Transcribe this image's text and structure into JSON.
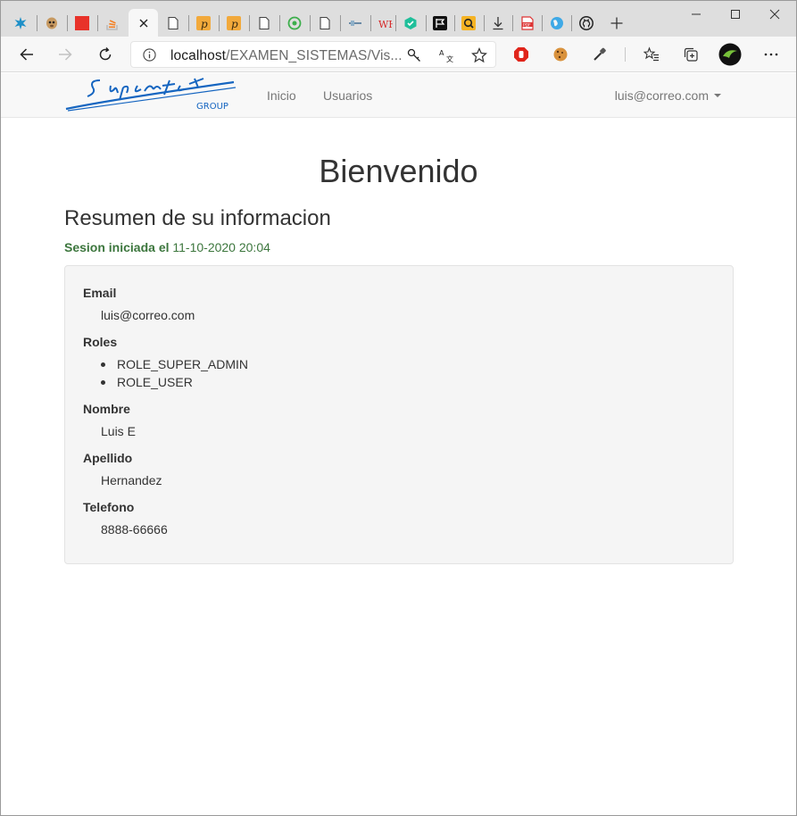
{
  "browser": {
    "url_host": "localhost",
    "url_path": "/EXAMEN_SISTEMAS/Vis...",
    "tabs": [
      {
        "icon": "star-burst-icon"
      },
      {
        "icon": "meerkat-icon"
      },
      {
        "icon": "red-square-icon"
      },
      {
        "icon": "stackoverflow-icon"
      },
      {
        "icon": "close-icon",
        "active": true
      },
      {
        "icon": "blank-page-icon"
      },
      {
        "icon": "p-badge-icon"
      },
      {
        "icon": "p-badge-icon"
      },
      {
        "icon": "blank-page-icon"
      },
      {
        "icon": "green-circle-icon"
      },
      {
        "icon": "blank-page-icon"
      },
      {
        "icon": "tool-icon"
      },
      {
        "icon": "wh-icon"
      },
      {
        "icon": "teal-cube-icon"
      },
      {
        "icon": "flag-icon"
      },
      {
        "icon": "search-q-icon"
      },
      {
        "icon": "download-icon"
      },
      {
        "icon": "pdf-icon"
      },
      {
        "icon": "globe-icon"
      },
      {
        "icon": "github-icon"
      }
    ]
  },
  "navbar": {
    "brand_text": "Sunpentex",
    "brand_sub": "GROUP",
    "links": [
      "Inicio",
      "Usuarios"
    ],
    "user": "luis@correo.com"
  },
  "main": {
    "title": "Bienvenido",
    "subtitle": "Resumen de su informacion",
    "session_label": "Sesion iniciada el",
    "session_time": "11-10-2020 20:04",
    "fields": {
      "email_label": "Email",
      "email": "luis@correo.com",
      "roles_label": "Roles",
      "roles": [
        "ROLE_SUPER_ADMIN",
        "ROLE_USER"
      ],
      "nombre_label": "Nombre",
      "nombre": "Luis E",
      "apellido_label": "Apellido",
      "apellido": "Hernandez",
      "telefono_label": "Telefono",
      "telefono": "8888-66666"
    }
  },
  "colors": {
    "brand_blue": "#1565c0",
    "session_green": "#3c763d",
    "well_bg": "#f5f5f5"
  }
}
